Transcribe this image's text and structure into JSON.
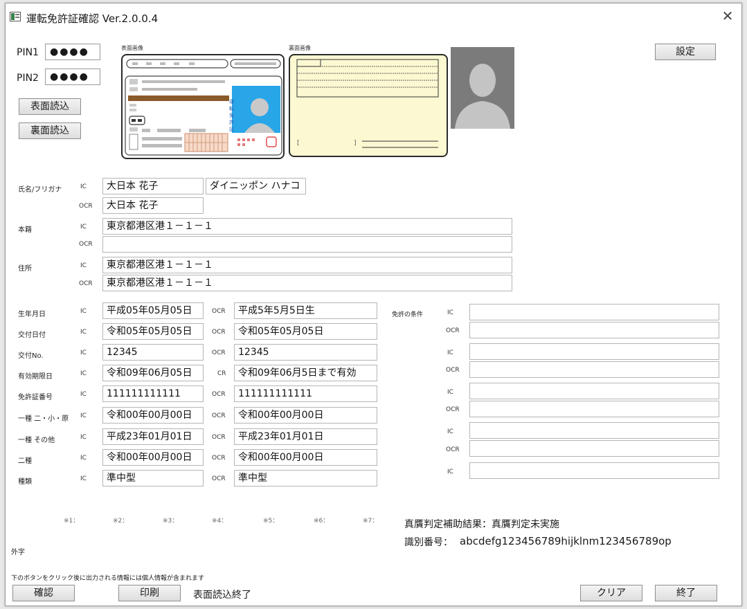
{
  "window": {
    "title": "運転免許証確認 Ver.2.0.0.4",
    "close_glyph": "✕"
  },
  "pins": [
    {
      "label": "PIN1",
      "value": "●●●●"
    },
    {
      "label": "PIN2",
      "value": "●●●●"
    }
  ],
  "buttons": {
    "front_read": "表面読込",
    "back_read": "裏面読込",
    "settings": "設定",
    "confirm": "確認",
    "print": "印刷",
    "clear": "クリア",
    "exit": "終了"
  },
  "images": {
    "front_label": "表面画像",
    "back_label": "裏面画像"
  },
  "card_front": {
    "vertical_text": "運転免許証"
  },
  "source_labels": {
    "ic": "IC",
    "ocr": "OCR",
    "cr": "CR"
  },
  "name_section": {
    "label": "氏名/フリガナ",
    "ic_name": "大日本 花子",
    "ic_kana": "ダイニッポン ハナコ",
    "ocr_name": "大日本 花子"
  },
  "honseki": {
    "label": "本籍",
    "ic": "東京都港区港１－１－１",
    "ocr": ""
  },
  "address": {
    "label": "住所",
    "ic": "東京都港区港１－１－１",
    "ocr": "東京都港区港１－１－１"
  },
  "detail_rows": [
    {
      "label": "生年月日",
      "ic": "平成05年05月05日",
      "ocr_label": "OCR",
      "ocr": "平成5年5月5日生"
    },
    {
      "label": "交付日付",
      "ic": "令和05年05月05日",
      "ocr_label": "OCR",
      "ocr": "令和05年05月05日"
    },
    {
      "label": "交付No.",
      "ic": "12345",
      "ocr_label": "OCR",
      "ocr": "12345"
    },
    {
      "label": "有効期限日",
      "ic": "令和09年06月05日",
      "ocr_label": "CR",
      "ocr": "令和09年06月5日まで有効"
    },
    {
      "label": "免許証番号",
      "ic": "111111111111",
      "ocr_label": "OCR",
      "ocr": "111111111111"
    },
    {
      "label": "一種 二・小・原",
      "ic": "令和00年00月00日",
      "ocr_label": "OCR",
      "ocr": "令和00年00月00日"
    },
    {
      "label": "一種 その他",
      "ic": "平成23年01月01日",
      "ocr_label": "OCR",
      "ocr": "平成23年01月01日"
    },
    {
      "label": "二種",
      "ic": "令和00年00月00日",
      "ocr_label": "OCR",
      "ocr": "令和00年00月00日"
    },
    {
      "label": "種類",
      "ic": "準中型",
      "ocr_label": "OCR",
      "ocr": "準中型"
    }
  ],
  "conditions": {
    "label": "免許の条件",
    "rows": [
      {
        "src": "IC",
        "value": ""
      },
      {
        "src": "OCR",
        "value": ""
      },
      {
        "src": "IC",
        "value": ""
      },
      {
        "src": "OCR",
        "value": ""
      },
      {
        "src": "IC",
        "value": ""
      },
      {
        "src": "OCR",
        "value": ""
      },
      {
        "src": "IC",
        "value": ""
      },
      {
        "src": "OCR",
        "value": ""
      },
      {
        "src": "IC",
        "value": ""
      }
    ]
  },
  "gaiji": {
    "label": "外字",
    "markers": [
      "※1：",
      "※2：",
      "※3：",
      "※4：",
      "※5：",
      "※6：",
      "※7："
    ]
  },
  "authenticity": {
    "result_label": "真贋判定補助結果：真贋判定未実施",
    "id_label": "識別番号：",
    "id_value": "abcdefg123456789hijklnm123456789op"
  },
  "footer": {
    "notice": "下のボタンをクリック後に出力される情報には個人情報が含まれます",
    "status": "表面読込終了"
  },
  "colors": {
    "photo_bg": "#7b7b7b",
    "card_back_bg": "#fbf8d2",
    "card_front_accent": "#8a5a2b",
    "card_front_photo_bg": "#29a6e8"
  }
}
